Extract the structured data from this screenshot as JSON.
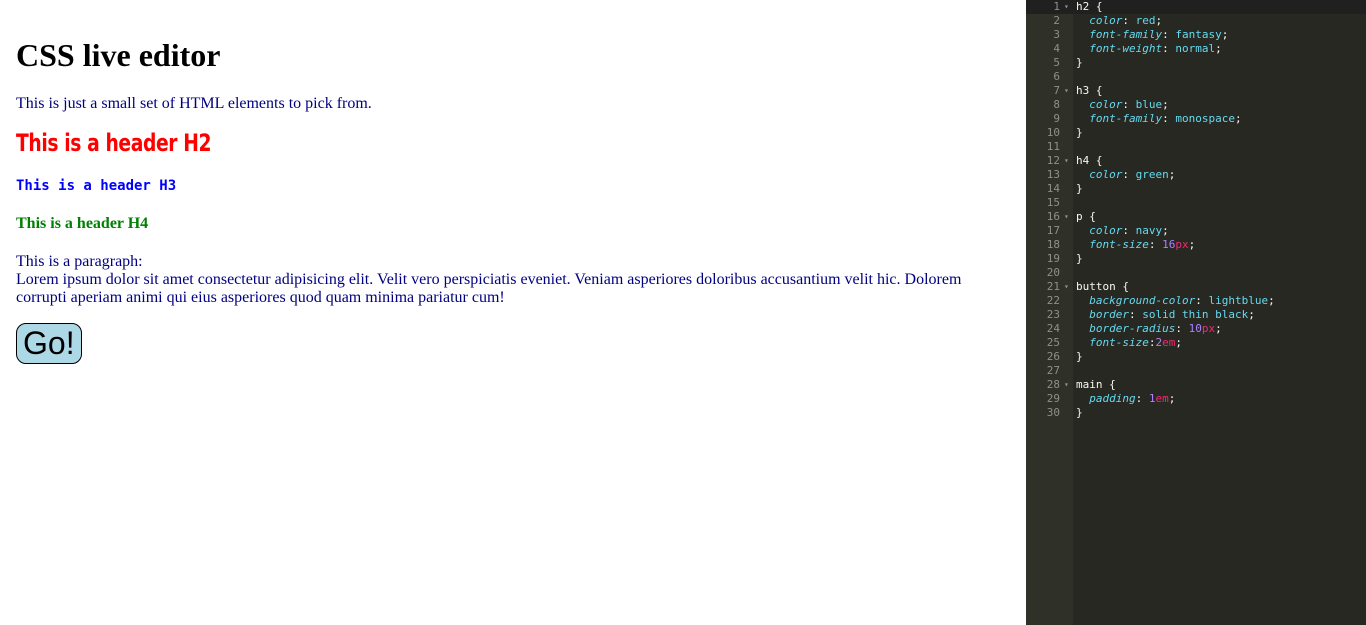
{
  "preview": {
    "title": "CSS live editor",
    "intro": "This is just a small set of HTML elements to pick from.",
    "h2": "This is a header H2",
    "h3": "This is a header H3",
    "h4": "This is a header H4",
    "paragraph_label": "This is a paragraph:",
    "paragraph_text": "Lorem ipsum dolor sit amet consectetur adipisicing elit. Velit vero perspiciatis eveniet. Veniam asperiores doloribus accusantium velit hic. Dolorem corrupti aperiam animi qui eius asperiores quod quam minima pariatur cum!",
    "button_label": "Go!"
  },
  "editor": {
    "colors": {
      "background": "#272822",
      "gutter": "#2f3129",
      "property": "#66d9ef",
      "number": "#ae81ff",
      "unit": "#f92672",
      "text": "#f8f8f2"
    },
    "lines": [
      {
        "n": "1",
        "fold": true,
        "tokens": [
          [
            "sel",
            "h2 "
          ],
          [
            "punc",
            "{"
          ]
        ]
      },
      {
        "n": "2",
        "tokens": [
          [
            "sp",
            "  "
          ],
          [
            "prop",
            "color"
          ],
          [
            "punc",
            ": "
          ],
          [
            "val",
            "red"
          ],
          [
            "punc",
            ";"
          ]
        ]
      },
      {
        "n": "3",
        "tokens": [
          [
            "sp",
            "  "
          ],
          [
            "prop",
            "font-family"
          ],
          [
            "punc",
            ": "
          ],
          [
            "val",
            "fantasy"
          ],
          [
            "punc",
            ";"
          ]
        ]
      },
      {
        "n": "4",
        "tokens": [
          [
            "sp",
            "  "
          ],
          [
            "prop",
            "font-weight"
          ],
          [
            "punc",
            ": "
          ],
          [
            "val",
            "normal"
          ],
          [
            "punc",
            ";"
          ]
        ]
      },
      {
        "n": "5",
        "tokens": [
          [
            "punc",
            "}"
          ]
        ]
      },
      {
        "n": "6",
        "tokens": []
      },
      {
        "n": "7",
        "fold": true,
        "tokens": [
          [
            "sel",
            "h3 "
          ],
          [
            "punc",
            "{"
          ]
        ]
      },
      {
        "n": "8",
        "tokens": [
          [
            "sp",
            "  "
          ],
          [
            "prop",
            "color"
          ],
          [
            "punc",
            ": "
          ],
          [
            "val",
            "blue"
          ],
          [
            "punc",
            ";"
          ]
        ]
      },
      {
        "n": "9",
        "tokens": [
          [
            "sp",
            "  "
          ],
          [
            "prop",
            "font-family"
          ],
          [
            "punc",
            ": "
          ],
          [
            "val",
            "monospace"
          ],
          [
            "punc",
            ";"
          ]
        ]
      },
      {
        "n": "10",
        "tokens": [
          [
            "punc",
            "}"
          ]
        ]
      },
      {
        "n": "11",
        "tokens": []
      },
      {
        "n": "12",
        "fold": true,
        "tokens": [
          [
            "sel",
            "h4 "
          ],
          [
            "punc",
            "{"
          ]
        ]
      },
      {
        "n": "13",
        "tokens": [
          [
            "sp",
            "  "
          ],
          [
            "prop",
            "color"
          ],
          [
            "punc",
            ": "
          ],
          [
            "val",
            "green"
          ],
          [
            "punc",
            ";"
          ]
        ]
      },
      {
        "n": "14",
        "tokens": [
          [
            "punc",
            "}"
          ]
        ]
      },
      {
        "n": "15",
        "tokens": []
      },
      {
        "n": "16",
        "fold": true,
        "tokens": [
          [
            "sel",
            "p "
          ],
          [
            "punc",
            "{"
          ]
        ]
      },
      {
        "n": "17",
        "tokens": [
          [
            "sp",
            "  "
          ],
          [
            "prop",
            "color"
          ],
          [
            "punc",
            ": "
          ],
          [
            "val",
            "navy"
          ],
          [
            "punc",
            ";"
          ]
        ]
      },
      {
        "n": "18",
        "tokens": [
          [
            "sp",
            "  "
          ],
          [
            "prop",
            "font-size"
          ],
          [
            "punc",
            ": "
          ],
          [
            "num",
            "16"
          ],
          [
            "unit",
            "px"
          ],
          [
            "punc",
            ";"
          ]
        ]
      },
      {
        "n": "19",
        "tokens": [
          [
            "punc",
            "}"
          ]
        ]
      },
      {
        "n": "20",
        "tokens": []
      },
      {
        "n": "21",
        "fold": true,
        "tokens": [
          [
            "sel",
            "button "
          ],
          [
            "punc",
            "{"
          ]
        ]
      },
      {
        "n": "22",
        "tokens": [
          [
            "sp",
            "  "
          ],
          [
            "prop",
            "background-color"
          ],
          [
            "punc",
            ": "
          ],
          [
            "val",
            "lightblue"
          ],
          [
            "punc",
            ";"
          ]
        ]
      },
      {
        "n": "23",
        "tokens": [
          [
            "sp",
            "  "
          ],
          [
            "prop",
            "border"
          ],
          [
            "punc",
            ": "
          ],
          [
            "val",
            "solid thin black"
          ],
          [
            "punc",
            ";"
          ]
        ]
      },
      {
        "n": "24",
        "tokens": [
          [
            "sp",
            "  "
          ],
          [
            "prop",
            "border-radius"
          ],
          [
            "punc",
            ": "
          ],
          [
            "num",
            "10"
          ],
          [
            "unit",
            "px"
          ],
          [
            "punc",
            ";"
          ]
        ]
      },
      {
        "n": "25",
        "tokens": [
          [
            "sp",
            "  "
          ],
          [
            "prop",
            "font-size"
          ],
          [
            "punc",
            ":"
          ],
          [
            "num",
            "2"
          ],
          [
            "unit",
            "em"
          ],
          [
            "punc",
            ";"
          ]
        ]
      },
      {
        "n": "26",
        "tokens": [
          [
            "punc",
            "}"
          ]
        ]
      },
      {
        "n": "27",
        "tokens": []
      },
      {
        "n": "28",
        "fold": true,
        "tokens": [
          [
            "sel",
            "main "
          ],
          [
            "punc",
            "{"
          ]
        ]
      },
      {
        "n": "29",
        "tokens": [
          [
            "sp",
            "  "
          ],
          [
            "prop",
            "padding"
          ],
          [
            "punc",
            ": "
          ],
          [
            "num",
            "1"
          ],
          [
            "unit",
            "em"
          ],
          [
            "punc",
            ";"
          ]
        ]
      },
      {
        "n": "30",
        "tokens": [
          [
            "punc",
            "}"
          ]
        ]
      }
    ]
  }
}
